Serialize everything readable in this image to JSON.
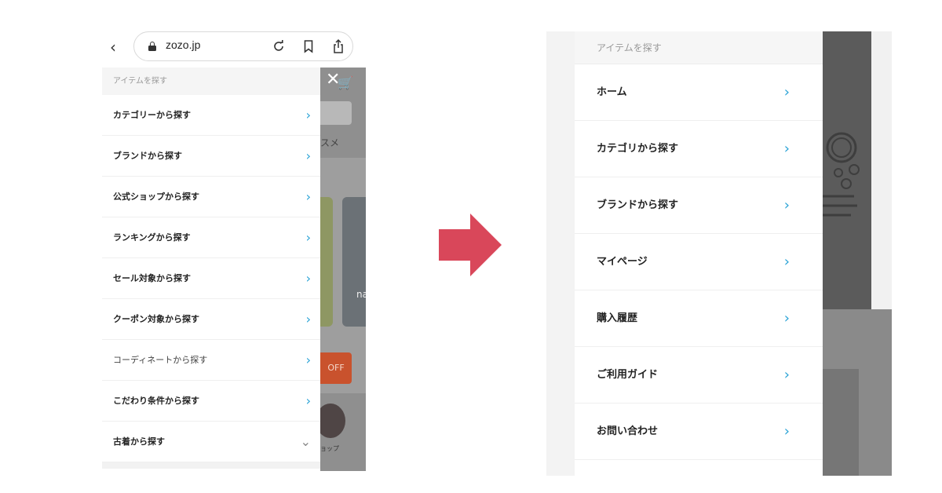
{
  "left": {
    "url": "zozo.jp",
    "menu_header": "アイテムを探す",
    "items": [
      {
        "label": "カテゴリーから探す",
        "chevron": "›"
      },
      {
        "label": "ブランドから探す",
        "chevron": "›"
      },
      {
        "label": "公式ショップから探す",
        "chevron": "›"
      },
      {
        "label": "ランキングから探す",
        "chevron": "›"
      },
      {
        "label": "セール対象から探す",
        "chevron": "›"
      },
      {
        "label": "クーポン対象から探す",
        "chevron": "›"
      },
      {
        "label": "コーディネートから探す",
        "chevron": "›"
      },
      {
        "label": "こだわり条件から探す",
        "chevron": "›"
      },
      {
        "label": "古着から探す",
        "chevron": "⌄"
      }
    ],
    "background": {
      "osusume": "スメ",
      "na": "na",
      "off": "OFF",
      "shop": "ョップ"
    },
    "icons": {
      "back": "chevron-left-icon",
      "lock": "lock-icon",
      "reload": "reload-icon",
      "bookmark": "bookmark-icon",
      "share": "share-icon",
      "close": "close-icon",
      "cart": "cart-icon"
    }
  },
  "right": {
    "menu_header": "アイテムを探す",
    "items": [
      {
        "label": "ホーム"
      },
      {
        "label": "カテゴリから探す"
      },
      {
        "label": "ブランドから探す"
      },
      {
        "label": "マイページ"
      },
      {
        "label": "購入履歴"
      },
      {
        "label": "ご利用ガイド"
      },
      {
        "label": "お問い合わせ"
      }
    ]
  },
  "colors": {
    "accent_chevron": "#2aa3d6",
    "arrow": "#d9475a",
    "off_badge": "#c9522d"
  }
}
